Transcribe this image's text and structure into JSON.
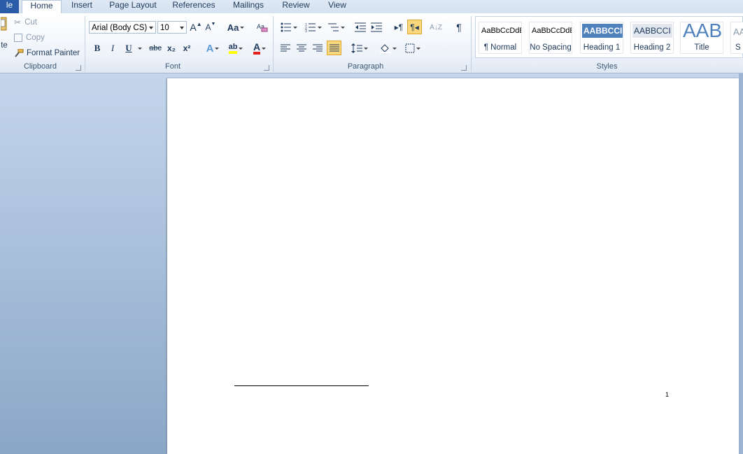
{
  "tabs": {
    "file": "le",
    "home": "Home",
    "insert": "Insert",
    "page_layout": "Page Layout",
    "references": "References",
    "mailings": "Mailings",
    "review": "Review",
    "view": "View"
  },
  "clipboard": {
    "paste_label": "te",
    "cut": "Cut",
    "copy": "Copy",
    "format_painter": "Format Painter",
    "group_label": "Clipboard"
  },
  "font": {
    "name": "Arial (Body CS)",
    "size": "10",
    "grow": "A",
    "shrink": "A",
    "change_case": "Aa",
    "bold": "B",
    "italic": "I",
    "underline": "U",
    "strike": "abc",
    "subscript": "x₂",
    "superscript": "x²",
    "text_effects": "A",
    "highlight": "ab",
    "font_color": "A",
    "group_label": "Font"
  },
  "paragraph": {
    "show_marks": "¶",
    "group_label": "Paragraph"
  },
  "styles": {
    "items": [
      {
        "sample": "AaBbCcDdE",
        "name": "¶ Normal"
      },
      {
        "sample": "AaBbCcDdE",
        "name": "No Spacing"
      },
      {
        "sample": "AABBCCI",
        "name": "Heading 1"
      },
      {
        "sample": "AABBCCI",
        "name": "Heading 2"
      },
      {
        "sample": "AAB",
        "name": "Title"
      },
      {
        "sample": "AA",
        "name": "S"
      }
    ],
    "group_label": "Styles"
  },
  "document": {
    "page_number": "1"
  },
  "colors": {
    "accent": "#2a5ba8",
    "heading1_bg": "#4f81bd",
    "highlight_yellow": "#ffff00",
    "font_red": "#e0201b"
  }
}
